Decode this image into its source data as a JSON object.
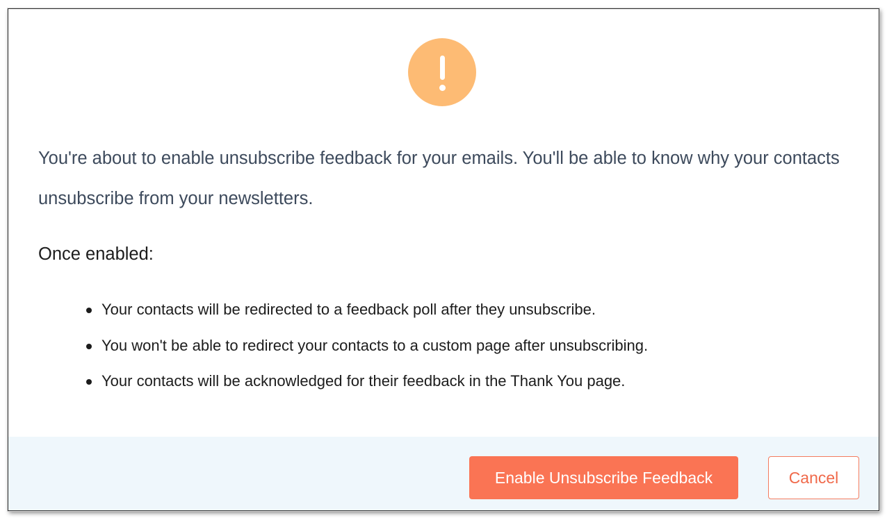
{
  "icon": {
    "name": "warning-exclamation-icon",
    "color": "#fdbb74"
  },
  "dialog": {
    "intro": "You're about to enable unsubscribe feedback for your emails. You'll be able to know why your contacts unsubscribe from your newsletters.",
    "once_heading": "Once enabled:",
    "bullets": [
      "Your contacts will be redirected to a feedback poll after they unsubscribe.",
      "You won't be able to redirect your contacts to a custom page after unsubscribing.",
      "Your contacts will be acknowledged for their feedback in the Thank You page."
    ]
  },
  "footer": {
    "primary_label": "Enable Unsubscribe Feedback",
    "cancel_label": "Cancel"
  },
  "colors": {
    "primary": "#fa7454",
    "footer_bg": "#eff7fc",
    "intro_text": "#3d4a5c"
  }
}
